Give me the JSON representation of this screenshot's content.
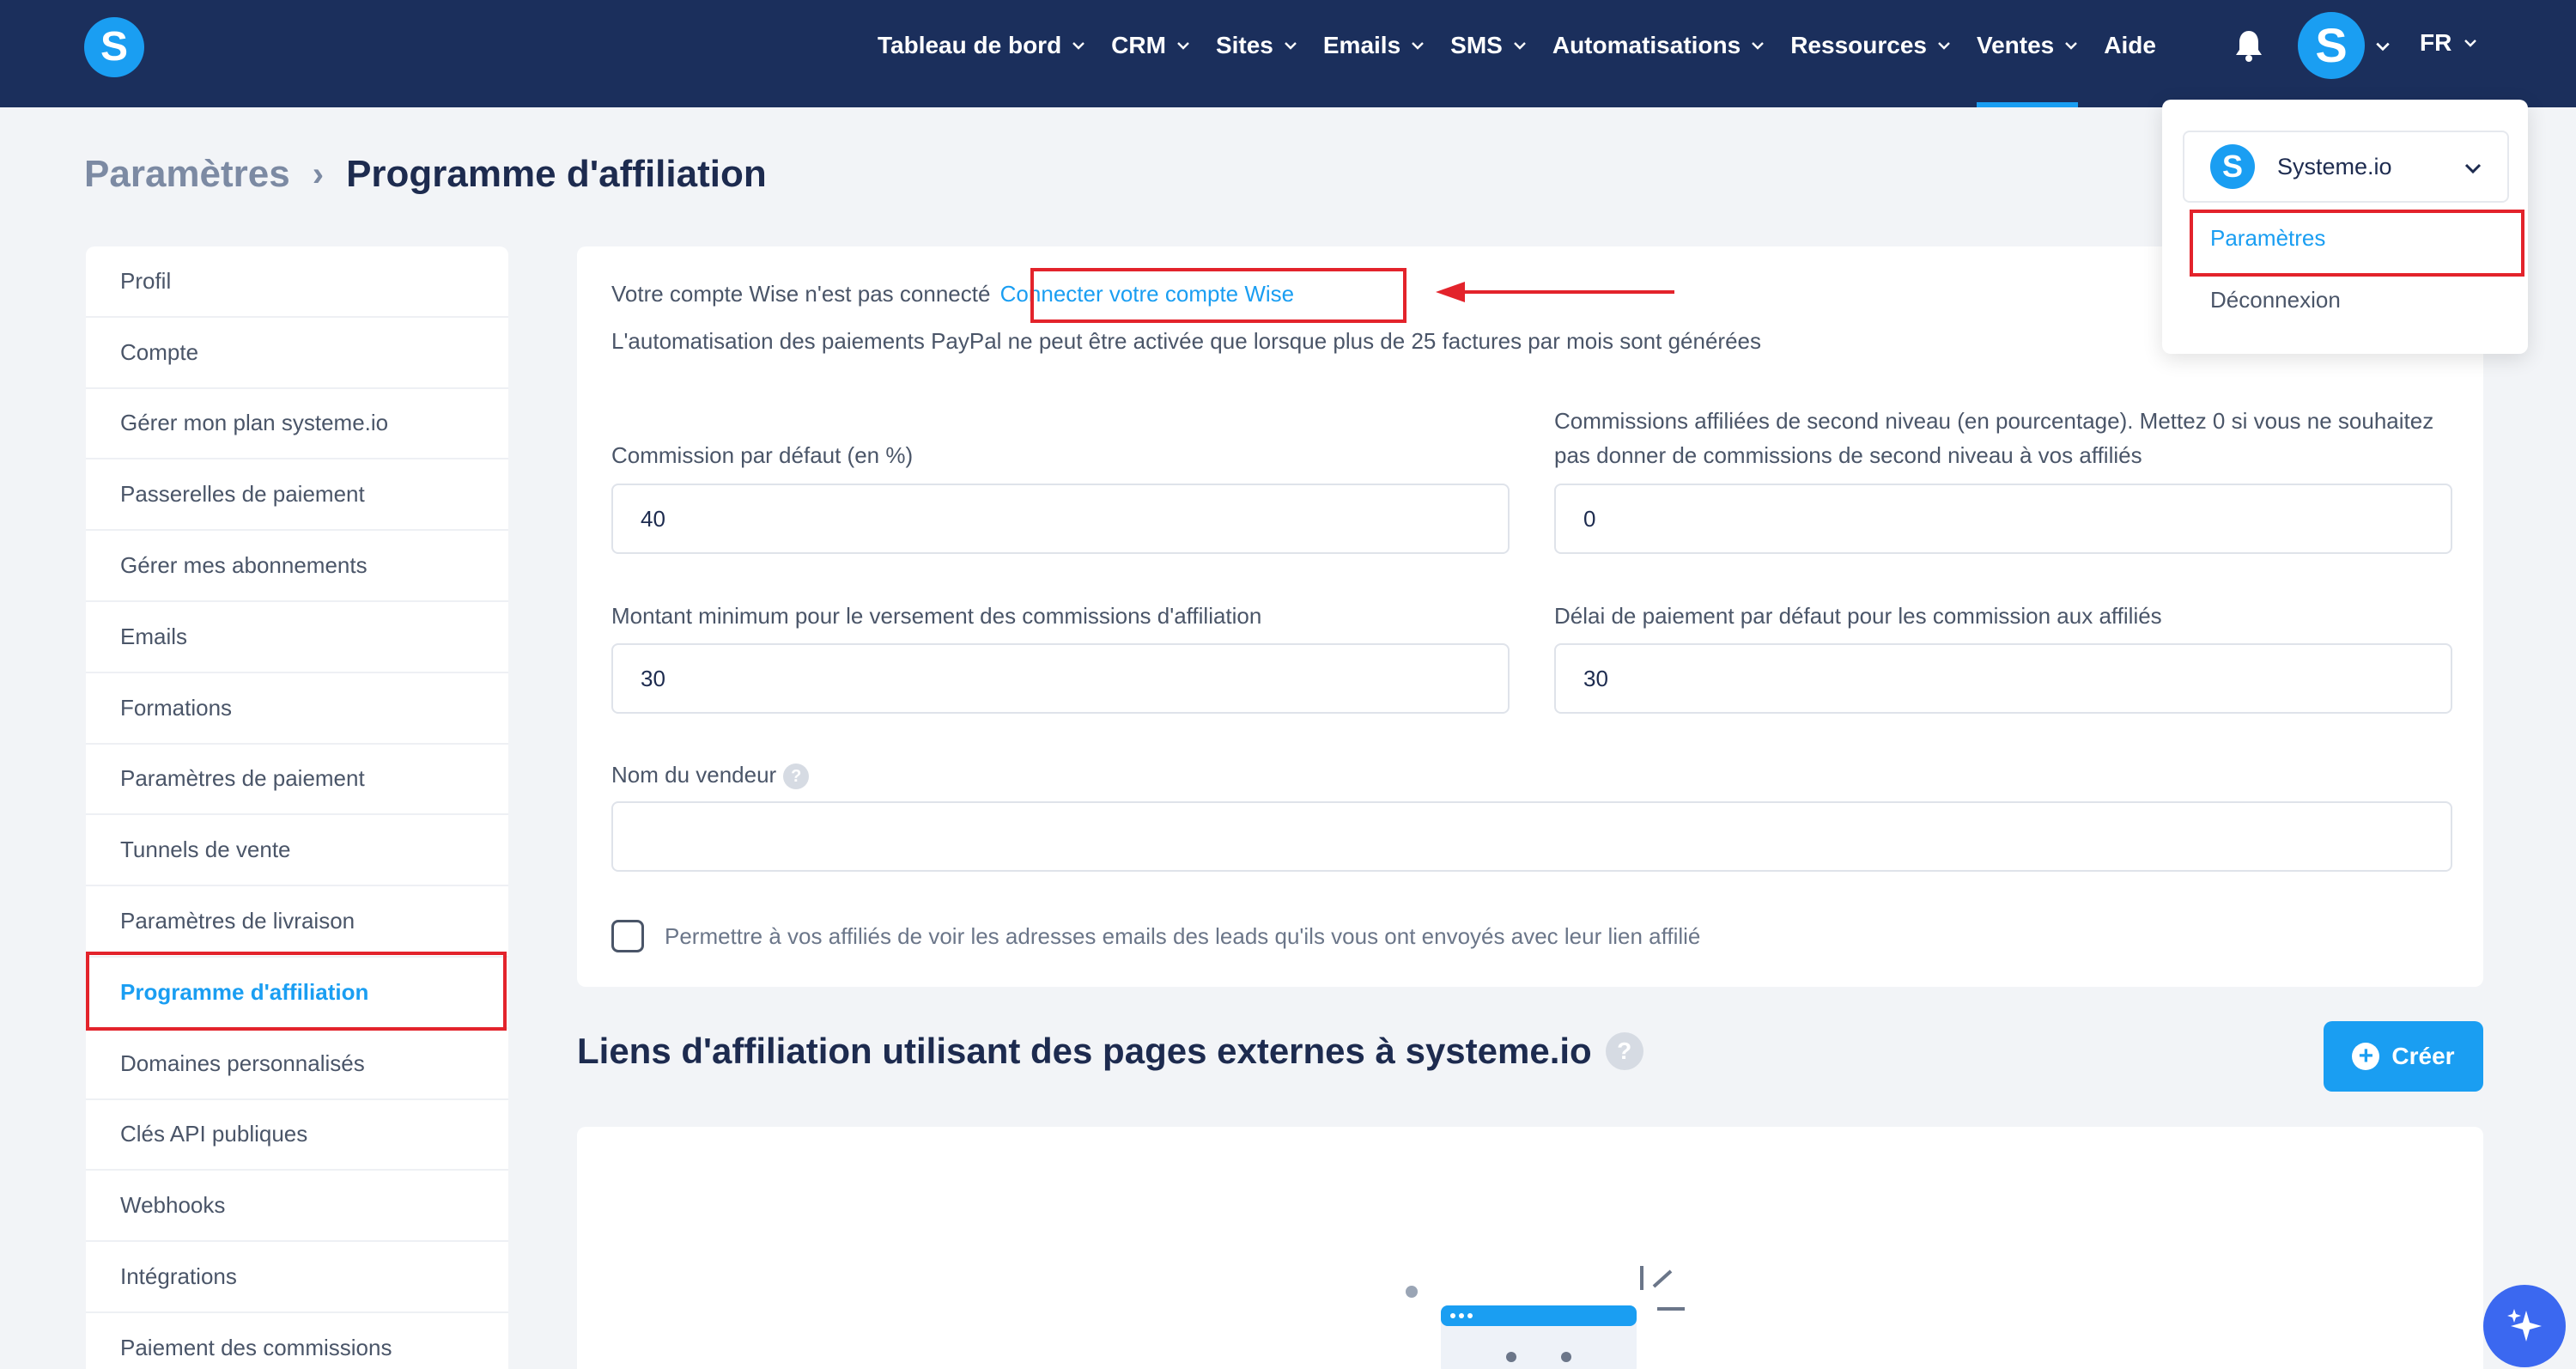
{
  "nav": {
    "items": [
      {
        "label": "Tableau de bord",
        "has_menu": true
      },
      {
        "label": "CRM",
        "has_menu": true
      },
      {
        "label": "Sites",
        "has_menu": true
      },
      {
        "label": "Emails",
        "has_menu": true
      },
      {
        "label": "SMS",
        "has_menu": true
      },
      {
        "label": "Automatisations",
        "has_menu": true
      },
      {
        "label": "Ressources",
        "has_menu": true
      },
      {
        "label": "Ventes",
        "has_menu": true,
        "active": true
      },
      {
        "label": "Aide",
        "has_menu": false
      }
    ],
    "logo_letter": "S",
    "avatar_letter": "S",
    "language": "FR"
  },
  "breadcrumb": {
    "parent": "Paramètres",
    "separator": "›",
    "current": "Programme d'affiliation"
  },
  "sidebar": {
    "items": [
      {
        "label": "Profil"
      },
      {
        "label": "Compte"
      },
      {
        "label": "Gérer mon plan systeme.io"
      },
      {
        "label": "Passerelles de paiement"
      },
      {
        "label": "Gérer mes abonnements"
      },
      {
        "label": "Emails"
      },
      {
        "label": "Formations"
      },
      {
        "label": "Paramètres de paiement"
      },
      {
        "label": "Tunnels de vente"
      },
      {
        "label": "Paramètres de livraison"
      },
      {
        "label": "Programme d'affiliation",
        "active": true
      },
      {
        "label": "Domaines personnalisés"
      },
      {
        "label": "Clés API publiques"
      },
      {
        "label": "Webhooks"
      },
      {
        "label": "Intégrations"
      },
      {
        "label": "Paiement des commissions"
      }
    ]
  },
  "form": {
    "wise_status": "Votre compte Wise n'est pas connecté",
    "wise_link": "Connecter votre compte Wise",
    "paypal_notice": "L'automatisation des paiements PayPal ne peut être activée que lorsque plus de 25 factures par mois sont générées",
    "default_commission_label": "Commission par défaut (en %)",
    "default_commission_value": "40",
    "second_level_label": "Commissions affiliées de second niveau (en pourcentage). Mettez 0 si vous ne souhaitez pas donner de commissions de second niveau à vos affiliés",
    "second_level_value": "0",
    "min_amount_label": "Montant minimum pour le versement des commissions d'affiliation",
    "min_amount_value": "30",
    "payment_delay_label": "Délai de paiement par défaut pour les commission aux affiliés",
    "payment_delay_value": "30",
    "seller_name_label": "Nom du vendeur",
    "seller_name_value": "",
    "help_glyph": "?",
    "show_emails_label": "Permettre à vos affiliés de voir les adresses emails des leads qu'ils vous ont envoyés avec leur lien affilié",
    "show_emails_checked": false
  },
  "external_links": {
    "title": "Liens d'affiliation utilisant des pages externes à systeme.io",
    "create_label": "Créer"
  },
  "account_menu": {
    "account_name": "Systeme.io",
    "settings_label": "Paramètres",
    "logout_label": "Déconnexion"
  },
  "colors": {
    "nav_bg": "#1b2f5c",
    "accent": "#1a9ef2",
    "highlight_red": "#e3232b",
    "page_bg": "#f2f4f7"
  }
}
